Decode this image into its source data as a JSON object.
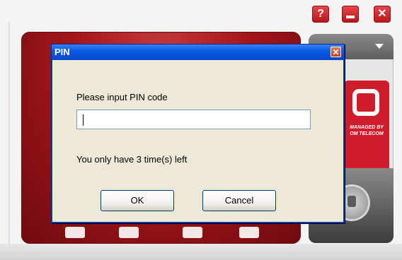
{
  "window_controls": {
    "help": "?",
    "close": "✕"
  },
  "background_app": {
    "logo_text": "MANAGED BY\nOM TELECOM"
  },
  "dialog": {
    "title": "PIN",
    "close_glyph": "✕",
    "prompt": "Please input PIN code",
    "input_value": "",
    "remaining_text": "You only have 3 time(s) left",
    "ok_label": "OK",
    "cancel_label": "Cancel"
  },
  "colors": {
    "accent_red": "#c0141b",
    "title_bar_blue": "#0a5ce4",
    "dialog_bg": "#ece9d8"
  }
}
